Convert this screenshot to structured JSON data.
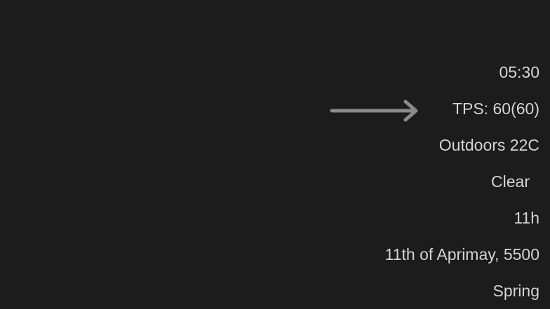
{
  "overlay": {
    "time": "05:30",
    "tps": "TPS: 60(60)",
    "temperature": "Outdoors 22C",
    "weather": "Clear",
    "hour": "11h",
    "date": "11th of Aprimay, 5500",
    "season": "Spring"
  },
  "colors": {
    "background": "#1c1c1c",
    "text": "#d6d6d6",
    "arrow": "#8a8a8a"
  },
  "annotation": {
    "icon": "right-arrow-icon"
  }
}
